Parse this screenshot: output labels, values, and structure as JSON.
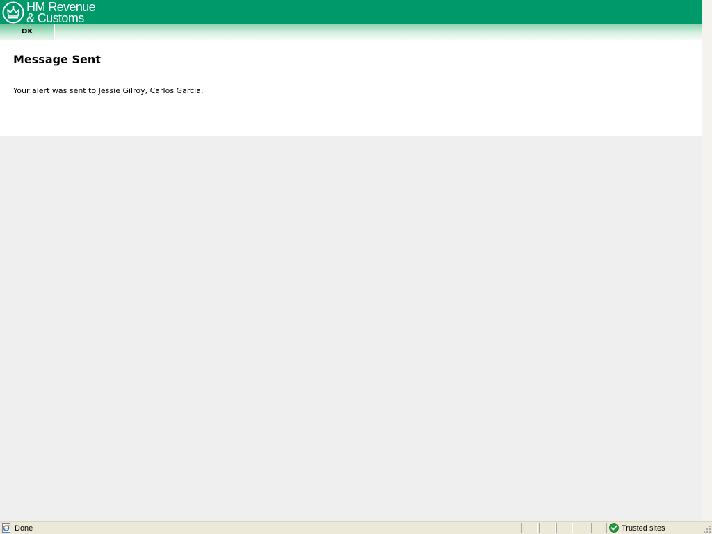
{
  "banner": {
    "logo_line1": "HM Revenue",
    "logo_line2": "& Customs",
    "color": "#00996a",
    "logo_icon": "crown-emblem-icon"
  },
  "toolbar": {
    "ok_label": "OK"
  },
  "main": {
    "title": "Message Sent",
    "message": "Your alert was sent to Jessie Gilroy, Carlos Garcia."
  },
  "statusbar": {
    "status_text": "Done",
    "zone_text": "Trusted sites",
    "status_icon": "ie-page-icon",
    "zone_icon": "trusted-check-icon"
  }
}
